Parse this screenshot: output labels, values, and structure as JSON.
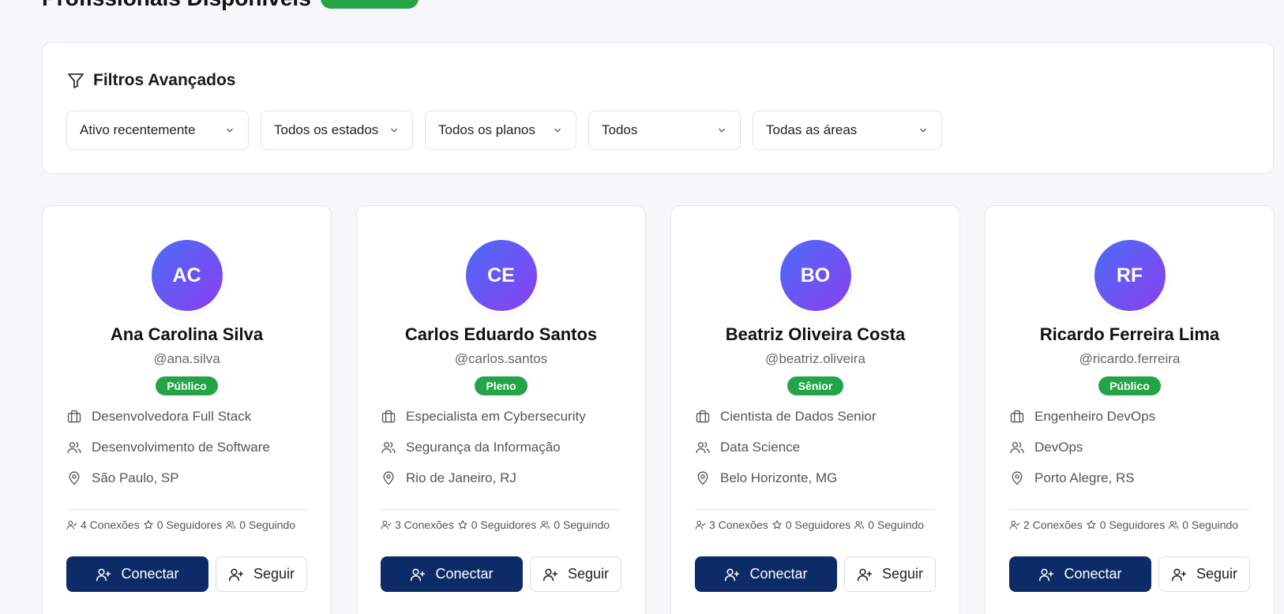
{
  "header": {
    "title": "Profissionais Disponíveis"
  },
  "filters": {
    "title": "Filtros Avançados",
    "selects": [
      {
        "value": "Ativo recentemente"
      },
      {
        "value": "Todos os estados"
      },
      {
        "value": "Todos os planos"
      },
      {
        "value": "Todos"
      },
      {
        "value": "Todas as áreas"
      }
    ]
  },
  "buttons": {
    "connect": "Conectar",
    "follow": "Seguir"
  },
  "profiles": [
    {
      "initials": "AC",
      "name": "Ana Carolina Silva",
      "handle": "@ana.silva",
      "badge": "Público",
      "role": "Desenvolvedora Full Stack",
      "area": "Desenvolvimento de Software",
      "location": "São Paulo, SP",
      "connections": "4 Conexões",
      "followers": "0 Seguidores",
      "following": "0 Seguindo"
    },
    {
      "initials": "CE",
      "name": "Carlos Eduardo Santos",
      "handle": "@carlos.santos",
      "badge": "Pleno",
      "role": "Especialista em Cybersecurity",
      "area": "Segurança da Informação",
      "location": "Rio de Janeiro, RJ",
      "connections": "3 Conexões",
      "followers": "0 Seguidores",
      "following": "0 Seguindo"
    },
    {
      "initials": "BO",
      "name": "Beatriz Oliveira Costa",
      "handle": "@beatriz.oliveira",
      "badge": "Sênior",
      "role": "Cientista de Dados Senior",
      "area": "Data Science",
      "location": "Belo Horizonte, MG",
      "connections": "3 Conexões",
      "followers": "0 Seguidores",
      "following": "0 Seguindo"
    },
    {
      "initials": "RF",
      "name": "Ricardo Ferreira Lima",
      "handle": "@ricardo.ferreira",
      "badge": "Público",
      "role": "Engenheiro DevOps",
      "area": "DevOps",
      "location": "Porto Alegre, RS",
      "connections": "2 Conexões",
      "followers": "0 Seguidores",
      "following": "0 Seguindo"
    }
  ],
  "colors": {
    "primary": "#0d2b66",
    "badge": "#22a447",
    "avatar_from": "#4b6cf7",
    "avatar_to": "#8a3ff0"
  }
}
